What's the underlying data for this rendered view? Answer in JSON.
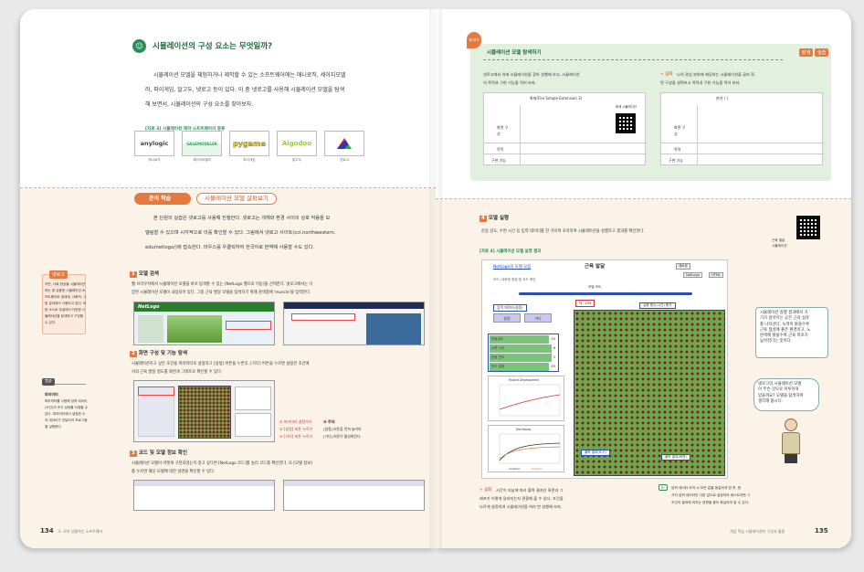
{
  "left": {
    "section_title": "시뮬레이션의 구성 요소는 무엇일까?",
    "intro": [
      "시뮬레이션 모델을 체험하거나 제작할 수 있는 소프트웨어에는 애니로직, 세이지모델",
      "러, 파이게임, 알고두, 넷로고 등이 있다. 이 중 넷로고를 사용해 시뮬레이션 모델을 탐색",
      "해 보면서, 시뮬레이션의 구성 요소를 찾아보자."
    ],
    "figure3_caption": "[자료 3]  시뮬레이션 제작 소프트웨어의 종류",
    "software": [
      {
        "logo": "anylogic",
        "name": "애니로직"
      },
      {
        "logo": "SAGEMODELER",
        "name": "세이지모델러"
      },
      {
        "logo": "pygame",
        "name": "파이게임"
      },
      {
        "logo": "Algodoo",
        "name": "알고두"
      },
      {
        "logo": "",
        "name": "넷로고"
      }
    ],
    "prep_badge": "준비 학습",
    "prep_title": "시뮬레이션 모델 살펴보기",
    "prep_text": [
      "본 단원의 실습은 넷로고를 사용해 진행한다. 넷로고는 개체와 환경 사이의 상호 작용을 모",
      "델링할 수 있으며 시각적으로 이를 확인할 수 있다. 그림에서 넷로고 사이트(ccl.northwestern.",
      "edu/netlogo/)에 접속한다. 마우스를 우클릭하여 한국어로 번역해 사용할 수도 있다."
    ],
    "sidebar_netlogo": {
      "tag": "넷로고",
      "text": [
        "자연, 사회 현상을 시뮬레이션",
        "하는 데 유용한 시뮬레이션 소",
        "프트웨어로 생태계, 사회적, 그",
        "림 분야에서 사용되고 있다. 또",
        "한 소스로 부설이터 다양한 시",
        "뮬레이션을 탐색하고 구성할",
        "수 있다."
      ]
    },
    "sidebar_tip": {
      "tag": "TIP",
      "heading": "파라미터",
      "text": [
        "파라미터를 사용해 입력 데이터",
        "(조건)의 초기 상태를 지정할 수",
        "있다. 파라미터에서 설정한 수",
        "치 데이터가 전달되어 프로그램",
        "을 실행한다."
      ]
    },
    "step1_title": "모델 검색",
    "step1_text": [
      "웹 브라우저에서 시뮬레이션 모델을 바로 탐색할 수 있는 [NetLogo 웹으로 이동]을 선택한다. 넷로고에서는 다",
      "양한 시뮬레이션 모델이 내장되어 있다. 그중 근육 발달 모델을 탐색하기 위해 검색창에 'muscle'을 입력한다."
    ],
    "netlogo_label": "NetLogo",
    "step2_title": "화면 구성 및 기능 탐색",
    "step2_text": [
      "시뮬레이션하고 싶은 조건을 파라미터로 설정하고 [설정] 버튼을 누른후, [가다] 버튼을 누르면 설정한 조건에",
      "서의 근육 발달 정도를 화면과 그래프로 확인할 수 있다."
    ],
    "step2_notes": [
      "① 파라미터 설정하기",
      "② [설정] 버튼 누르기",
      "③ [가다] 버튼 누르기"
    ],
    "caution_title": "주의",
    "caution_text": [
      "[설정] 버튼을 먼저 눌러야",
      "[가다] 버튼이 활성화된다."
    ],
    "step3_title": "코드 및 모델 정보 확인",
    "step3_text": [
      "시뮬레이션 모델이 어떻게 구현되었는지 알고 싶다면 [NetLogo 코드]를 눌러 코드를 확인한다. 또 [모델 정보]",
      "를 누르면 해당 모델에 대한 설명을 확인할 수 있다."
    ],
    "page_number": "134",
    "footer": "4. 모의 상황하는 소프트웨어"
  },
  "right": {
    "badge": "해 보기",
    "top_title": "시뮬레이션 모델 탐색하기",
    "top_tags": [
      "탐색",
      "실습"
    ],
    "top_left_text": [
      "넷로고에서 아래 시뮬레이션을 찾아 실행해 보고, 시뮬레이션",
      "의 목적과 구현 기능을 적어 보자."
    ],
    "top_table_title": "화재(Fire Simple Extension 3)",
    "top_table_qr": "화재 시뮬레이션",
    "top_table_rows": [
      "화면 구성",
      "목적",
      "구현 기능"
    ],
    "top_right_prefix": "+ 심화",
    "top_right_text": [
      "나의 관심 분야에 해당하는 시뮬레이션을 골라 화",
      "면 구성을 살펴보고 목적과 구현 기능을 적어 보자."
    ],
    "top_right_field": "분야 (          )",
    "step4_title": "모델 실행",
    "step4_text": "운동 강도, 수면 시간 등 입력 데이터를 한 가지씩 조작하여 시뮬레이션을 실행하고 결과를 확인한다.",
    "qr_label": [
      "근육 발달",
      "시뮬레이션"
    ],
    "figure4_caption": "[자료 4]  시뮬레이션 모델 실행 결과",
    "sim": {
      "link": "NetLogo의 모델 모음",
      "title": "근육 발달",
      "buttons": [
        "재로운",
        "NetLogo",
        "HTML"
      ],
      "meta": "보드: 대화형    명령 및 코드 확인",
      "speed": "모델 속도",
      "tick": "틱: 149",
      "param_label": "입력 데이터(설정)",
      "btn_setup": "설정",
      "btn_go": "가다",
      "sliders": [
        {
          "name": "운동강도",
          "value": "50"
        },
        {
          "name": "수면 시간",
          "value": "8"
        },
        {
          "name": "운동 빈도",
          "value": "5"
        },
        {
          "name": "빈도 설정",
          "value": "60"
        }
      ],
      "chart1_title": "Muscle Development",
      "chart2_title": "Hormones",
      "chart2_legend": [
        "anabolic",
        "catabolic"
      ],
      "run_label": "실행 횟수(시간) 증가",
      "output_label": "출력 결과(도구)",
      "result_label": "출력 결과(화면)"
    },
    "callout1": [
      "시뮬레이션 실행 결과에서 가",
      "기가 길어지는 곳은 근육 섬유",
      "를 나타낸다. 녹색이 밝을수록",
      "근육 형성에 좋은 환경이고, 노",
      "란색에 밝을수록 근육 피로가",
      "높아진다는 뜻이다."
    ],
    "callout2": [
      "넷로고의 시뮬레이션 모델",
      "이 무슨 것으로 이루어져",
      "있을까요? 모델을 탐색하며",
      "생각해 봅시다."
    ],
    "bottom_prefix": "+ 심화",
    "bottom_text": [
      "시간이 지남에 따라 출력 결과인 화면과 그",
      "래프가 어떻게 달라지는지 관찰해 볼 수 있다. 조건을",
      "다르게 설정하여 시뮬레이션을 여러 번 실행해 보자."
    ],
    "bottom_right": [
      "입력 데이터 조작 시 모든 값을 동일하게 한 후, 한",
      "가지 입력 데이터만 다른 값으로 설정하여 테스트하면 그",
      "조건이 결과에 미치는 영향을 좀더 확실하게 알 수 있다."
    ],
    "footer": "개념 학습   시뮬레이션의 구성과 활용",
    "page_number": "135"
  }
}
